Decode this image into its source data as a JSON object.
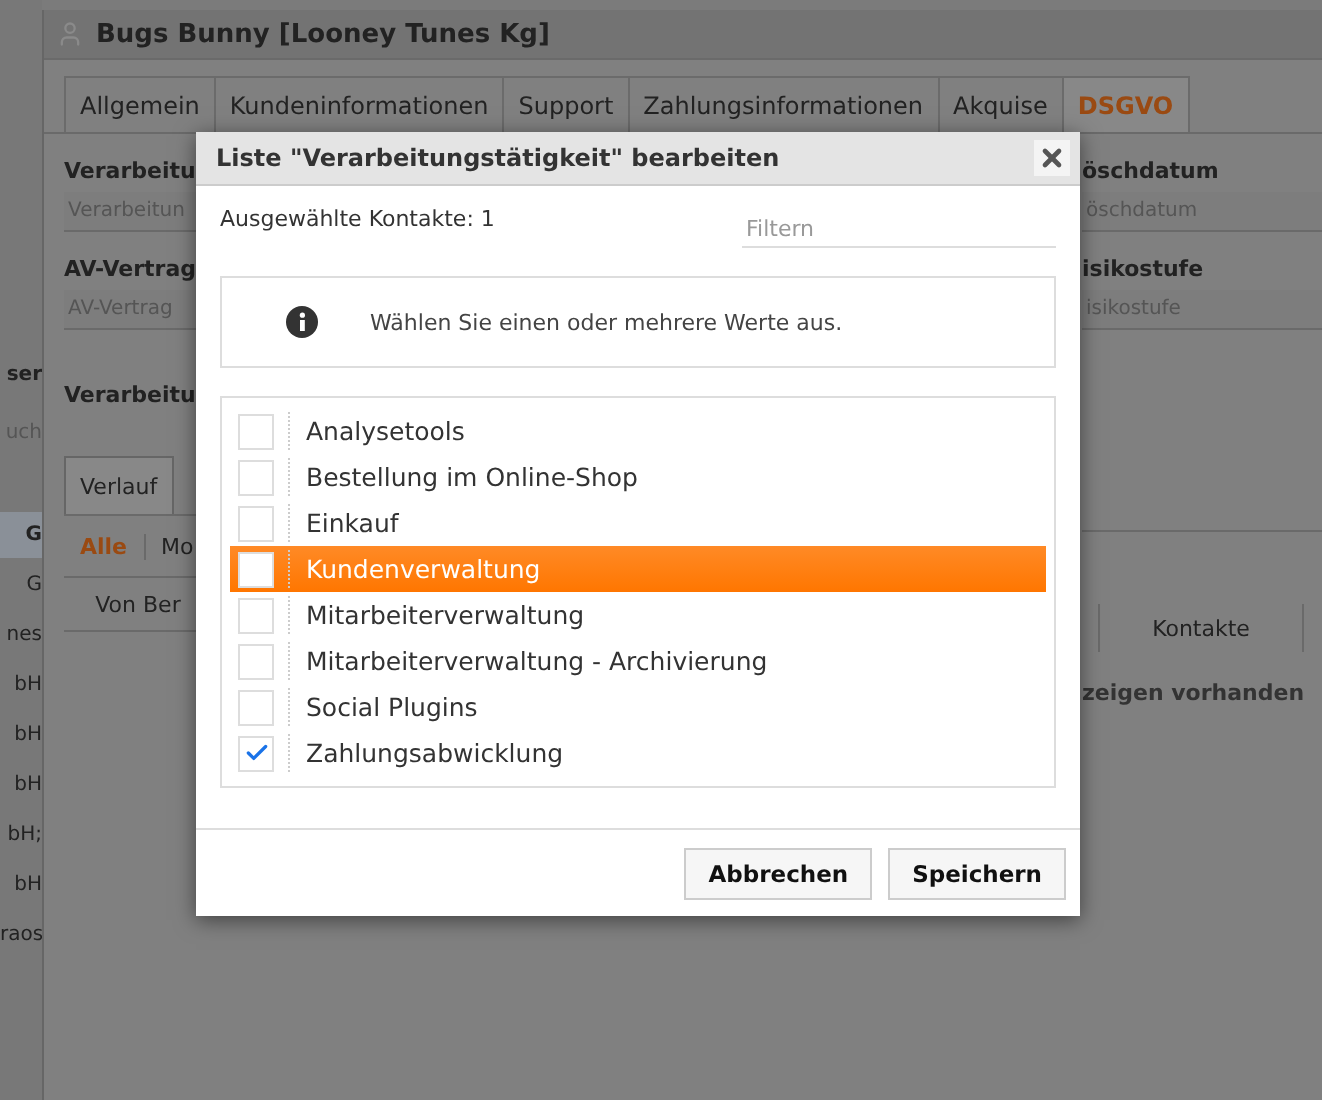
{
  "side_list": {
    "items": [
      {
        "kind": "heading",
        "text": "ser",
        "selected": false
      },
      {
        "kind": "field",
        "text": "uch",
        "selected": false
      },
      {
        "kind": "row",
        "text": "G",
        "selected": true
      },
      {
        "kind": "row",
        "text": "G",
        "selected": false
      },
      {
        "kind": "row",
        "text": "nes",
        "selected": false
      },
      {
        "kind": "row",
        "text": "bH",
        "selected": false
      },
      {
        "kind": "row",
        "text": "bH",
        "selected": false
      },
      {
        "kind": "row",
        "text": "bH",
        "selected": false
      },
      {
        "kind": "row",
        "text": "bH;",
        "selected": false
      },
      {
        "kind": "row",
        "text": "bH",
        "selected": false
      },
      {
        "kind": "row",
        "text": "raos",
        "selected": false
      }
    ]
  },
  "window": {
    "title": "Bugs Bunny [Looney Tunes Kg]",
    "tabs": [
      {
        "label": "Allgemein",
        "selected": false
      },
      {
        "label": "Kundeninformationen",
        "selected": false
      },
      {
        "label": "Support",
        "selected": false
      },
      {
        "label": "Zahlungsinformationen",
        "selected": false
      },
      {
        "label": "Akquise",
        "selected": false
      },
      {
        "label": "DSGVO",
        "selected": true
      }
    ],
    "left_column": {
      "fields": [
        {
          "label": "Verarbeitu",
          "placeholder": "Verarbeitun"
        },
        {
          "label": "AV-Vertrag",
          "placeholder": "AV-Vertrag"
        }
      ],
      "section_title": "Verarbeitu",
      "tabs": [
        {
          "label": "Verlauf",
          "selected": true
        }
      ],
      "filters": [
        {
          "label": "Alle",
          "selected": true
        },
        {
          "label": "Mo",
          "selected": false
        }
      ],
      "table_column": "Von Ber"
    },
    "right_column": {
      "fields": [
        {
          "label": "öschdatum",
          "placeholder": "öschdatum"
        },
        {
          "label": "isikostufe",
          "placeholder": "isikostufe"
        }
      ],
      "table_column": "Kontakte",
      "empty_message": "zeigen vorhanden"
    }
  },
  "dialog": {
    "title": "Liste \"Verarbeitungstätigkeit\" bearbeiten",
    "selected_count": "Ausgewählte Kontakte: 1",
    "filter": {
      "placeholder": "Filtern"
    },
    "info": "Wählen Sie einen oder mehrere Werte aus.",
    "options": [
      {
        "label": "Analysetools",
        "checked": false,
        "selected": false
      },
      {
        "label": "Bestellung im Online-Shop",
        "checked": false,
        "selected": false
      },
      {
        "label": "Einkauf",
        "checked": false,
        "selected": false
      },
      {
        "label": "Kundenverwaltung",
        "checked": false,
        "selected": true
      },
      {
        "label": "Mitarbeiterverwaltung",
        "checked": false,
        "selected": false
      },
      {
        "label": "Mitarbeiterverwaltung - Archivierung",
        "checked": false,
        "selected": false
      },
      {
        "label": "Social Plugins",
        "checked": false,
        "selected": false
      },
      {
        "label": "Zahlungsabwicklung",
        "checked": true,
        "selected": false
      }
    ],
    "buttons": [
      "Abbrechen",
      "Speichern"
    ]
  }
}
